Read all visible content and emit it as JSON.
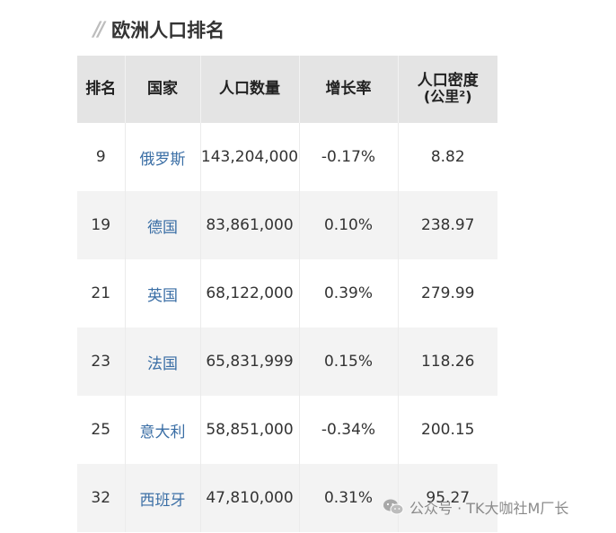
{
  "heading": {
    "prefix": "//",
    "title": "欧洲人口排名"
  },
  "table": {
    "columns": [
      "排名",
      "国家",
      "人口数量",
      "增长率"
    ],
    "density_header": {
      "line1": "人口密度",
      "line2": "(公里²)"
    },
    "rows": [
      {
        "rank": "9",
        "country": "俄罗斯",
        "population": "143,204,000",
        "growth": "-0.17%",
        "density": "8.82"
      },
      {
        "rank": "19",
        "country": "德国",
        "population": "83,861,000",
        "growth": "0.10%",
        "density": "238.97"
      },
      {
        "rank": "21",
        "country": "英国",
        "population": "68,122,000",
        "growth": "0.39%",
        "density": "279.99"
      },
      {
        "rank": "23",
        "country": "法国",
        "population": "65,831,999",
        "growth": "0.15%",
        "density": "118.26"
      },
      {
        "rank": "25",
        "country": "意大利",
        "population": "58,851,000",
        "growth": "-0.34%",
        "density": "200.15"
      },
      {
        "rank": "32",
        "country": "西班牙",
        "population": "47,810,000",
        "growth": "0.31%",
        "density": "95.27"
      }
    ]
  },
  "watermark": {
    "icon": "wechat-icon",
    "text": "公众号 · TK大咖社M厂长"
  }
}
